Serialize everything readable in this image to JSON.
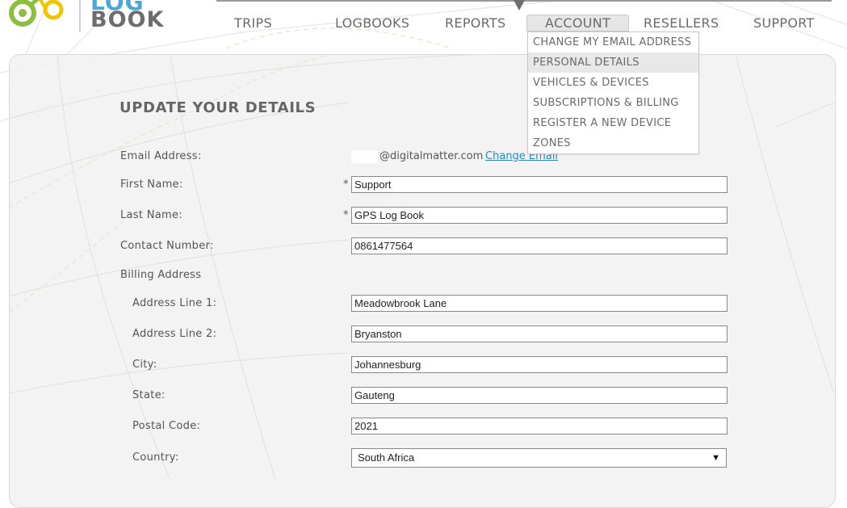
{
  "logo": {
    "text_top": "LOG",
    "text": "BOOK"
  },
  "nav": {
    "items": [
      "TRIPS",
      "LOGBOOKS",
      "REPORTS",
      "ACCOUNT",
      "RESELLERS",
      "SUPPORT"
    ],
    "active": "ACCOUNT"
  },
  "account_menu": {
    "items": [
      "CHANGE MY EMAIL ADDRESS",
      "PERSONAL DETAILS",
      "VEHICLES & DEVICES",
      "SUBSCRIPTIONS & BILLING",
      "REGISTER A NEW DEVICE",
      "ZONES"
    ],
    "highlighted": "PERSONAL DETAILS"
  },
  "form": {
    "title": "UPDATE YOUR DETAILS",
    "required_mark": "*",
    "email": {
      "label": "Email Address:",
      "domain": "@digitalmatter.com",
      "change_link": "Change Email"
    },
    "first_name": {
      "label": "First Name:",
      "value": "Support"
    },
    "last_name": {
      "label": "Last Name:",
      "value": "GPS Log Book"
    },
    "contact_number": {
      "label": "Contact Number:",
      "value": "0861477564"
    },
    "billing_heading": "Billing Address",
    "address_line_1": {
      "label": "Address Line 1:",
      "value": "Meadowbrook Lane"
    },
    "address_line_2": {
      "label": "Address Line 2:",
      "value": "Bryanston"
    },
    "city": {
      "label": "City:",
      "value": "Johannesburg"
    },
    "state": {
      "label": "State:",
      "value": "Gauteng"
    },
    "postal_code": {
      "label": "Postal Code:",
      "value": "2021"
    },
    "country": {
      "label": "Country:",
      "value": "South Africa",
      "arrow": "▼"
    }
  },
  "colors": {
    "accent_green": "#8dbf3f",
    "accent_yellow": "#f2c400",
    "accent_blue": "#4aa8d8",
    "link": "#2a86c4"
  }
}
